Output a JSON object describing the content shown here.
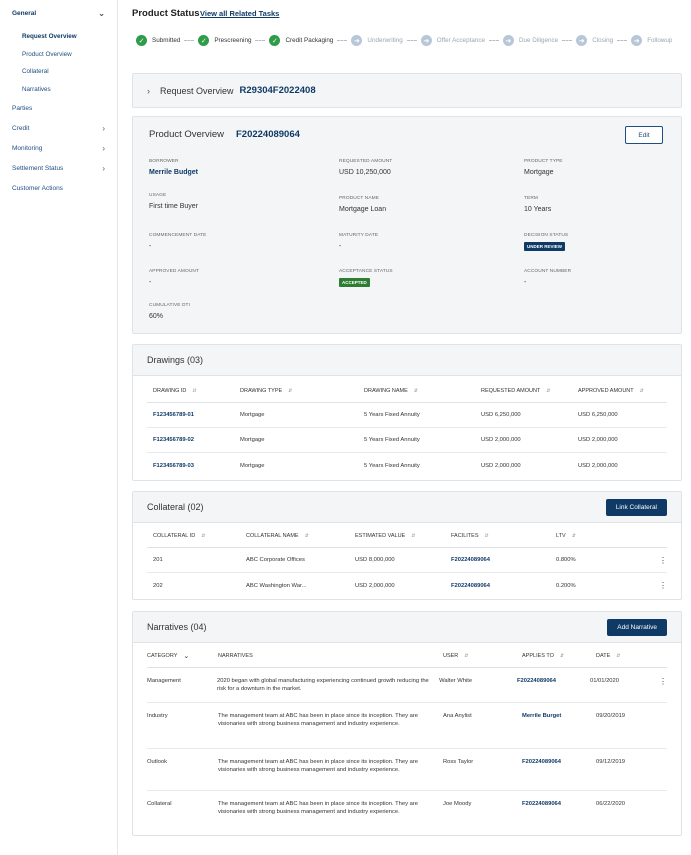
{
  "sidebar": {
    "general": "General",
    "sub": [
      "Request Overview",
      "Product Overview",
      "Collateral",
      "Narratives"
    ],
    "parties": "Parties",
    "credit": "Credit",
    "monitoring": "Monitoring",
    "settlement": "Settlement Status",
    "customer_actions": "Customer Actions"
  },
  "header": {
    "title": "Product Status",
    "link": "View all Related Tasks"
  },
  "stepper": [
    {
      "label": "Submitted",
      "status": "done"
    },
    {
      "label": "Prescreening",
      "status": "done"
    },
    {
      "label": "Credit Packaging",
      "status": "done"
    },
    {
      "label": "Underwriting",
      "status": "todo"
    },
    {
      "label": "Offer Acceptance",
      "status": "todo"
    },
    {
      "label": "Due Diligence",
      "status": "todo"
    },
    {
      "label": "Closing",
      "status": "todo"
    },
    {
      "label": "Followup",
      "status": "todo"
    }
  ],
  "request": {
    "label": "Request Overview",
    "id": "R29304F2022408"
  },
  "product": {
    "title": "Product Overview",
    "id": "F20224089064",
    "edit": "Edit",
    "fields": {
      "borrower": {
        "k": "BORROWER",
        "v": "Merrile Budget"
      },
      "requested_amount": {
        "k": "REQUESTED AMOUNT",
        "v": "USD 10,250,000"
      },
      "product_type": {
        "k": "PRODUCT TYPE",
        "v": "Mortgage"
      },
      "usage": {
        "k": "USAGE",
        "v": "First time Buyer"
      },
      "product_name": {
        "k": "PRODUCT NAME",
        "v": "Mortgage Loan"
      },
      "term": {
        "k": "TERM",
        "v": "10 Years"
      },
      "commencement": {
        "k": "COMMENCEMENT DATE",
        "v": "-"
      },
      "maturity": {
        "k": "MATURITY DATE",
        "v": "-"
      },
      "decision": {
        "k": "DECISION STATUS",
        "v": "UNDER REVIEW"
      },
      "approved": {
        "k": "APPROVED AMOUNT",
        "v": "-"
      },
      "acceptance": {
        "k": "ACCEPTANCE STATUS",
        "v": "ACCEPTED"
      },
      "account": {
        "k": "ACCOUNT NUMBER",
        "v": "-"
      },
      "dti": {
        "k": "CUMULATIVE DTI",
        "v": "60%"
      }
    }
  },
  "drawings": {
    "title": "Drawings (03)",
    "headers": [
      "DRAWING ID",
      "DRAWING TYPE",
      "DRAWING NAME",
      "REQUESTED AMOUNT",
      "APPROVED AMOUNT"
    ],
    "rows": [
      [
        "F123456789-01",
        "Mortgage",
        "5 Years Fixed Annuity",
        "USD  6,250,000",
        "USD  6,250,000"
      ],
      [
        "F123456789-02",
        "Mortgage",
        "5 Years Fixed Annuity",
        "USD  2,000,000",
        "USD  2,000,000"
      ],
      [
        "F123456789-03",
        "Mortgage",
        "5 Years Fixed Annuity",
        "USD  2,000,000",
        "USD  2,000,000"
      ]
    ]
  },
  "collateral": {
    "title": "Collateral (02)",
    "button": "Link Collateral",
    "headers": [
      "COLLATERAL ID",
      "COLLATERAL NAME",
      "ESTIMATED VALUE",
      "FACILITES",
      "LTV"
    ],
    "rows": [
      [
        "201",
        "ABC Corporate Offices",
        "USD    8,000,000",
        "F20224089064",
        "0.800%"
      ],
      [
        "202",
        "ABC Washington War...",
        "USD    2,000,000",
        "F20224089064",
        "0.200%"
      ]
    ]
  },
  "narratives": {
    "title": "Narratives (04)",
    "button": "Add Narrative",
    "headers": [
      "CATEGORY",
      "NARRATIVES",
      "USER",
      "APPLIES TO",
      "DATE"
    ],
    "rows": [
      [
        "Management",
        "2020 began with global manufacturing experiencing continued growth reducing the risk for a downturn in the market.",
        "Walter White",
        "F20224089064",
        "01/01/2020"
      ],
      [
        "Industry",
        "The management team at ABC has been in place since its inception. They are visionaries with strong business management and industry experience.",
        "Ana Anylist",
        "Merrile  Burget",
        "09/20/2019"
      ],
      [
        "Outlook",
        "The management team at ABC has been in place since its inception. They are visionaries with strong business management and industry experience.",
        "Ross Taylor",
        "F20224089064",
        "09/12/2019"
      ],
      [
        "Collateral",
        "The management team at ABC has been in place since its inception. They are visionaries with strong business management and industry experience.",
        "Joe Moody",
        "F20224089064",
        "06/22/2020"
      ]
    ]
  },
  "colors": {
    "primary": "#0f3a66",
    "success": "#2e9c49",
    "pending": "#b8c7d8"
  }
}
